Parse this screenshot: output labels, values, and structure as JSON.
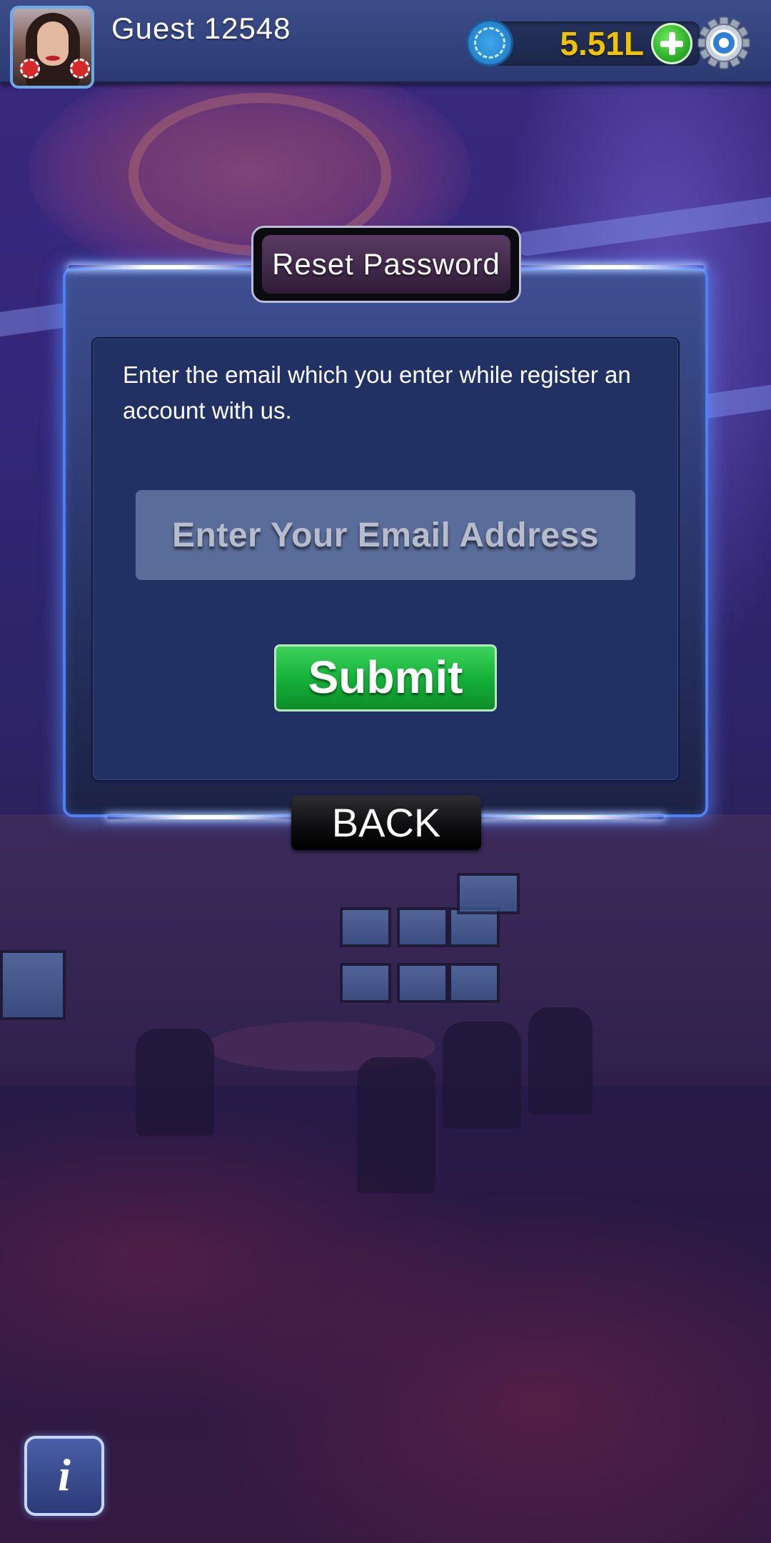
{
  "header": {
    "username": "Guest 12548",
    "balance": "5.51L",
    "balance_color": "#f2c200"
  },
  "dialog": {
    "title": "Reset Password",
    "instructions": "Enter the email which you enter while register an account with us.",
    "email_placeholder": "Enter Your Email Address",
    "submit_label": "Submit",
    "back_label": "BACK"
  },
  "footer": {
    "info_label": "i"
  },
  "icons": {
    "avatar": "avatar-photo",
    "chip": "chip-icon",
    "add": "plus-icon",
    "settings": "gear-icon"
  },
  "colors": {
    "accent_green": "#15b23a",
    "dialog_border": "#4f7ff5",
    "panel_bg": "#213164"
  }
}
